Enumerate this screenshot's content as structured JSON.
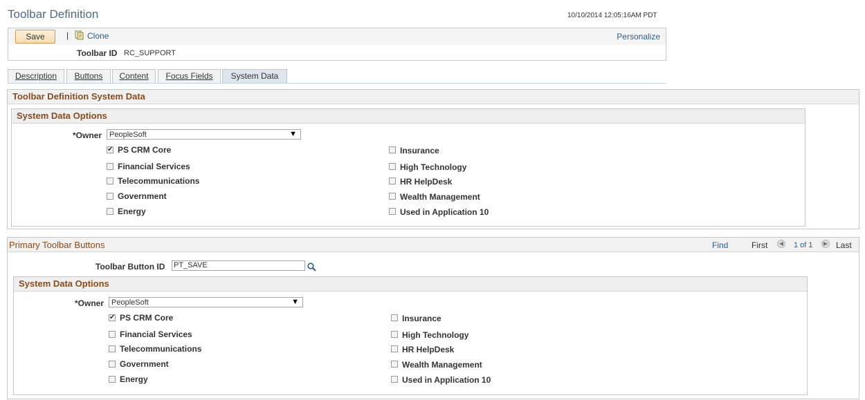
{
  "page": {
    "title": "Toolbar Definition",
    "timestamp": "10/10/2014 12:05:16AM PDT"
  },
  "toolbar": {
    "save_label": "Save",
    "separator": "|",
    "clone_label": "Clone",
    "personalize_label": "Personalize"
  },
  "key": {
    "label": "Toolbar ID",
    "value": "RC_SUPPORT"
  },
  "tabs": [
    {
      "label": "Description"
    },
    {
      "label": "Buttons"
    },
    {
      "label": "Content"
    },
    {
      "label": "Focus Fields"
    },
    {
      "label": "System Data",
      "active": true
    }
  ],
  "definition": {
    "title": "Toolbar Definition System Data",
    "options": {
      "title": "System Data Options",
      "owner_label": "*Owner",
      "owner_value": "PeopleSoft",
      "checkboxes": [
        {
          "label": "PS CRM Core",
          "checked": true
        },
        {
          "label": "Financial Services",
          "checked": false
        },
        {
          "label": "Telecommunications",
          "checked": false
        },
        {
          "label": "Government",
          "checked": false
        },
        {
          "label": "Energy",
          "checked": false
        },
        {
          "label": "Insurance",
          "checked": false
        },
        {
          "label": "High Technology",
          "checked": false
        },
        {
          "label": "HR HelpDesk",
          "checked": false
        },
        {
          "label": "Wealth Management",
          "checked": false
        },
        {
          "label": "Used in Application 10",
          "checked": false
        }
      ]
    }
  },
  "buttons_grid": {
    "title": "Primary Toolbar Buttons",
    "find_label": "Find",
    "first_label": "First",
    "page_count": "1 of 1",
    "last_label": "Last",
    "button_id_label": "Toolbar Button ID",
    "button_id_value": "PT_SAVE",
    "options": {
      "title": "System Data Options",
      "owner_label": "*Owner",
      "owner_value": "PeopleSoft",
      "checkboxes": [
        {
          "label": "PS CRM Core",
          "checked": true
        },
        {
          "label": "Financial Services",
          "checked": false
        },
        {
          "label": "Telecommunications",
          "checked": false
        },
        {
          "label": "Government",
          "checked": false
        },
        {
          "label": "Energy",
          "checked": false
        },
        {
          "label": "Insurance",
          "checked": false
        },
        {
          "label": "High Technology",
          "checked": false
        },
        {
          "label": "HR HelpDesk",
          "checked": false
        },
        {
          "label": "Wealth Management",
          "checked": false
        },
        {
          "label": "Used in Application 10",
          "checked": false
        }
      ]
    }
  },
  "icons": {
    "clone": "clone-icon",
    "lookup": "search-icon",
    "prev": "chevron-left-icon",
    "next": "chevron-right-icon",
    "dropdown": "chevron-down-icon"
  },
  "colors": {
    "title": "#4d6a8a",
    "section_header": "#8a4b1d",
    "link": "#2a5d8f",
    "save_button": "#f6dcb0"
  }
}
